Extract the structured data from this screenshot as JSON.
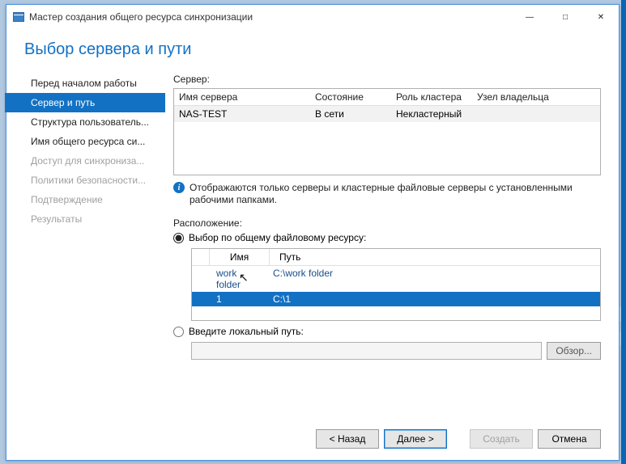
{
  "titlebar": {
    "title": "Мастер создания общего ресурса синхронизации"
  },
  "heading": "Выбор сервера и пути",
  "sidebar": {
    "items": [
      {
        "label": "Перед началом работы"
      },
      {
        "label": "Сервер и путь"
      },
      {
        "label": "Структура пользователь..."
      },
      {
        "label": "Имя общего ресурса си..."
      },
      {
        "label": "Доступ для синхрониза..."
      },
      {
        "label": "Политики безопасности..."
      },
      {
        "label": "Подтверждение"
      },
      {
        "label": "Результаты"
      }
    ]
  },
  "server": {
    "label": "Сервер:",
    "columns": {
      "name": "Имя сервера",
      "state": "Состояние",
      "role": "Роль кластера",
      "owner": "Узел владельца"
    },
    "rows": [
      {
        "name": "NAS-TEST",
        "state": "В сети",
        "role": "Некластерный",
        "owner": ""
      }
    ],
    "info": "Отображаются только серверы и кластерные файловые серверы с установленными рабочими папками."
  },
  "location": {
    "label": "Расположение:",
    "radio_share": "Выбор по общему файловому ресурсу:",
    "radio_local": "Введите локальный путь:",
    "share_columns": {
      "name": "Имя",
      "path": "Путь"
    },
    "share_rows": [
      {
        "name": "work folder",
        "path": "C:\\work folder"
      },
      {
        "name": "1",
        "path": "C:\\1"
      }
    ],
    "local_value": "",
    "browse": "Обзор..."
  },
  "buttons": {
    "back": "< Назад",
    "next": "Далее >",
    "create": "Создать",
    "cancel": "Отмена"
  }
}
